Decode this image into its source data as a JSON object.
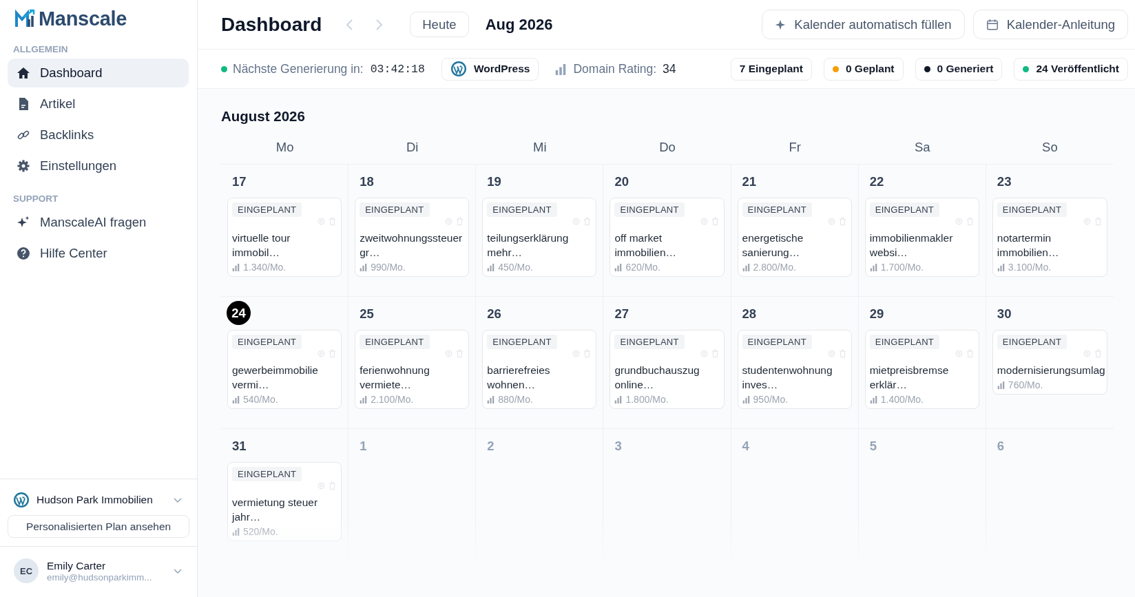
{
  "sidebar": {
    "logo": "Manscale",
    "sections": [
      {
        "title": "ALLGEMEIN",
        "items": [
          {
            "label": "Dashboard",
            "selected": true
          },
          {
            "label": "Artikel",
            "selected": false
          },
          {
            "label": "Backlinks",
            "selected": false
          },
          {
            "label": "Einstellungen",
            "selected": false
          }
        ]
      },
      {
        "title": "SUPPORT",
        "items": [
          {
            "label": "ManscaleAI fragen",
            "selected": false
          },
          {
            "label": "Hilfe Center",
            "selected": false
          }
        ]
      }
    ],
    "site": {
      "name": "Hudson Park Immobilien",
      "plan_button": "Personalisierten Plan ansehen"
    },
    "user": {
      "initials": "EC",
      "name": "Emily Carter",
      "email": "emily@hudsonparkimm..."
    }
  },
  "header": {
    "title": "Dashboard",
    "today_button": "Heute",
    "month": "Aug 2026",
    "buttons": [
      "Kalender automatisch füllen",
      "Kalender-Anleitung"
    ]
  },
  "status_bar": {
    "countdown_label": "Nächste Generierung in:",
    "countdown": "03:42:18",
    "platform": "WordPress",
    "rating_label": "Domain Rating:",
    "rating": "34",
    "counts": [
      {
        "label": "7 Eingeplant"
      },
      {
        "label": "0 Geplant",
        "color": "#f59e0b"
      },
      {
        "label": "0 Generiert",
        "color": "#111827"
      },
      {
        "label": "24 Veröffentlicht",
        "color": "#10b981"
      }
    ]
  },
  "calendar": {
    "title": "August 2026",
    "weekdays": [
      "Mo",
      "Di",
      "Mi",
      "Do",
      "Fr",
      "Sa",
      "So"
    ],
    "weeks": [
      {
        "days": [
          {
            "date": "17",
            "today": false,
            "outside": false,
            "entries": [
              {
                "status": "EINGEPLANT",
                "title": "virtuelle tour immobil…",
                "volume": "1.340/Mo."
              }
            ]
          },
          {
            "date": "18",
            "today": false,
            "outside": false,
            "entries": [
              {
                "status": "EINGEPLANT",
                "title": "zweitwohnungssteuer gr…",
                "volume": "990/Mo."
              }
            ]
          },
          {
            "date": "19",
            "today": false,
            "outside": false,
            "entries": [
              {
                "status": "EINGEPLANT",
                "title": "teilungserklärung mehr…",
                "volume": "450/Mo."
              }
            ]
          },
          {
            "date": "20",
            "today": false,
            "outside": false,
            "entries": [
              {
                "status": "EINGEPLANT",
                "title": "off market immobilien…",
                "volume": "620/Mo."
              }
            ]
          },
          {
            "date": "21",
            "today": false,
            "outside": false,
            "entries": [
              {
                "status": "EINGEPLANT",
                "title": "energetische sanierung…",
                "volume": "2.800/Mo."
              }
            ]
          },
          {
            "date": "22",
            "today": false,
            "outside": false,
            "entries": [
              {
                "status": "EINGEPLANT",
                "title": "immobilienmakler websi…",
                "volume": "1.700/Mo."
              }
            ]
          },
          {
            "date": "23",
            "today": false,
            "outside": false,
            "entries": [
              {
                "status": "EINGEPLANT",
                "title": "notartermin immobilien…",
                "volume": "3.100/Mo."
              }
            ]
          }
        ]
      },
      {
        "days": [
          {
            "date": "24",
            "today": true,
            "outside": false,
            "entries": [
              {
                "status": "EINGEPLANT",
                "title": "gewerbeimmobilie vermi…",
                "volume": "540/Mo."
              }
            ]
          },
          {
            "date": "25",
            "today": false,
            "outside": false,
            "entries": [
              {
                "status": "EINGEPLANT",
                "title": "ferienwohnung vermiete…",
                "volume": "2.100/Mo."
              }
            ]
          },
          {
            "date": "26",
            "today": false,
            "outside": false,
            "entries": [
              {
                "status": "EINGEPLANT",
                "title": "barrierefreies wohnen…",
                "volume": "880/Mo."
              }
            ]
          },
          {
            "date": "27",
            "today": false,
            "outside": false,
            "entries": [
              {
                "status": "EINGEPLANT",
                "title": "grundbuchauszug online…",
                "volume": "1.800/Mo."
              }
            ]
          },
          {
            "date": "28",
            "today": false,
            "outside": false,
            "entries": [
              {
                "status": "EINGEPLANT",
                "title": "studentenwohnung inves…",
                "volume": "950/Mo."
              }
            ]
          },
          {
            "date": "29",
            "today": false,
            "outside": false,
            "entries": [
              {
                "status": "EINGEPLANT",
                "title": "mietpreisbremse erklär…",
                "volume": "1.400/Mo."
              }
            ]
          },
          {
            "date": "30",
            "today": false,
            "outside": false,
            "entries": [
              {
                "status": "EINGEPLANT",
                "title": "modernisierungsumlag",
                "volume": "760/Mo."
              }
            ]
          }
        ]
      },
      {
        "days": [
          {
            "date": "31",
            "today": false,
            "outside": false,
            "entries": [
              {
                "status": "EINGEPLANT",
                "title": "vermietung steuer jahr…",
                "volume": "520/Mo."
              }
            ]
          },
          {
            "date": "1",
            "today": false,
            "outside": true
          },
          {
            "date": "2",
            "today": false,
            "outside": true
          },
          {
            "date": "3",
            "today": false,
            "outside": true
          },
          {
            "date": "4",
            "today": false,
            "outside": true
          },
          {
            "date": "5",
            "today": false,
            "outside": true
          },
          {
            "date": "6",
            "today": false,
            "outside": true
          }
        ]
      }
    ]
  }
}
